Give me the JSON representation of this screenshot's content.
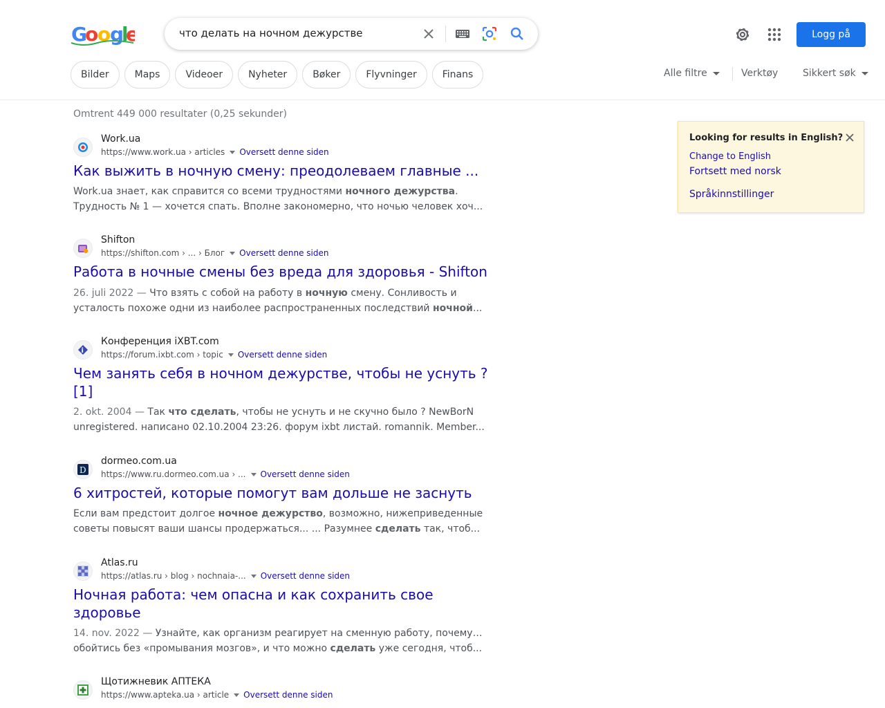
{
  "search": {
    "query": "что делать на ночном дежурстве",
    "stats": "Omtrent 449 000 resultater (0,25 sekunder)"
  },
  "header": {
    "sign_in": "Logg på"
  },
  "chips": [
    "Bilder",
    "Maps",
    "Videoer",
    "Nyheter",
    "Bøker",
    "Flyvninger",
    "Finans"
  ],
  "tools": {
    "all_filters": "Alle filtre",
    "tools": "Verktøy",
    "safe_search": "Sikkert søk"
  },
  "results": [
    {
      "site": "Work.ua",
      "url": "https://www.work.ua › articles",
      "translate": "Oversett denne siden",
      "title": "Как выжить в ночную смену: преодолеваем главные ...",
      "snippet_line1_pre": "Work.ua знает, как справится со всеми трудностями ",
      "snippet_line1_bold": "ночного дежурства",
      "snippet_line1_post": ".",
      "snippet_line2": "Трудность № 1 — хочется спать. Вполне закономерно, что ночью человек хоч..."
    },
    {
      "site": "Shifton",
      "url": "https://shifton.com › ... › Блог",
      "translate": "Oversett denne siden",
      "title": "Работа в ночные смены без вреда для здоровья - Shifton",
      "date": "26. juli 2022 —",
      "snippet_line1_pre": " Что взять с собой на работу в ",
      "snippet_line1_bold": "ночную",
      "snippet_line1_post": " смену. Сонливость и",
      "snippet_line2_pre": "усталость похоже одни из наиболее распространенных последствий ",
      "snippet_line2_bold": "ночной",
      "snippet_line2_post": "..."
    },
    {
      "site": "Конференция iXBT.com",
      "url": "https://forum.ixbt.com › topic",
      "translate": "Oversett denne siden",
      "title_line1": "Чем занять себя в ночном дежурстве, чтобы не уснуть ?",
      "title_line2": "[1]",
      "date": "2. okt. 2004 —",
      "snippet_line1_pre": " Так ",
      "snippet_line1_bold": "что сделать",
      "snippet_line1_post": ", чтобы не уснуть и не скучно было ? NewBorN",
      "snippet_line2": "unregistered. написано 02.10.2004 23:26. форум ixbt листай. romannik. Member..."
    },
    {
      "site": "dormeo.com.ua",
      "url": "https://www.ru.dormeo.com.ua › ...",
      "translate": "Oversett denne siden",
      "title": "6 хитростей, которые помогут вам дольше не заснуть",
      "snippet_line1_pre": "Если вам предстоит долгое ",
      "snippet_line1_bold": "ночное дежурство",
      "snippet_line1_post": ", возможно, нижеприведенные",
      "snippet_line2_pre": "советы повысят ваши шансы продержаться... ... Разумнее ",
      "snippet_line2_bold": "сделать",
      "snippet_line2_post": " так, чтоб..."
    },
    {
      "site": "Atlas.ru",
      "url": "https://atlas.ru › blog › nochnaia-...",
      "translate": "Oversett denne siden",
      "title_line1": "Ночная работа: чем опасна и как сохранить свое",
      "title_line2": "здоровье",
      "date": "14. nov. 2022 —",
      "snippet_line1_post": " Узнайте, как организм реагирует на сменную работу, почему не",
      "snippet_line2_pre": "обойтись без «промывания мозгов», и что можно ",
      "snippet_line2_bold": "сделать",
      "snippet_line2_post": " уже сегодня, чтоб..."
    },
    {
      "site": "Щотижневик АПТЕКА",
      "url": "https://www.apteka.ua › article",
      "translate": "Oversett denne siden"
    }
  ],
  "language_box": {
    "title": "Looking for results in English?",
    "link1": "Change to English",
    "link2": "Fortsett med norsk",
    "link3": "Språkinnstillinger"
  },
  "icons": [
    "google-logo",
    "clear-icon",
    "keyboard-icon",
    "lens-icon",
    "search-icon",
    "gear-icon",
    "apps-icon",
    "close-icon"
  ],
  "colors": {
    "link": "#1a0dab",
    "primary_button": "#1a73e8",
    "lang_box_bg": "#fef7e0"
  }
}
